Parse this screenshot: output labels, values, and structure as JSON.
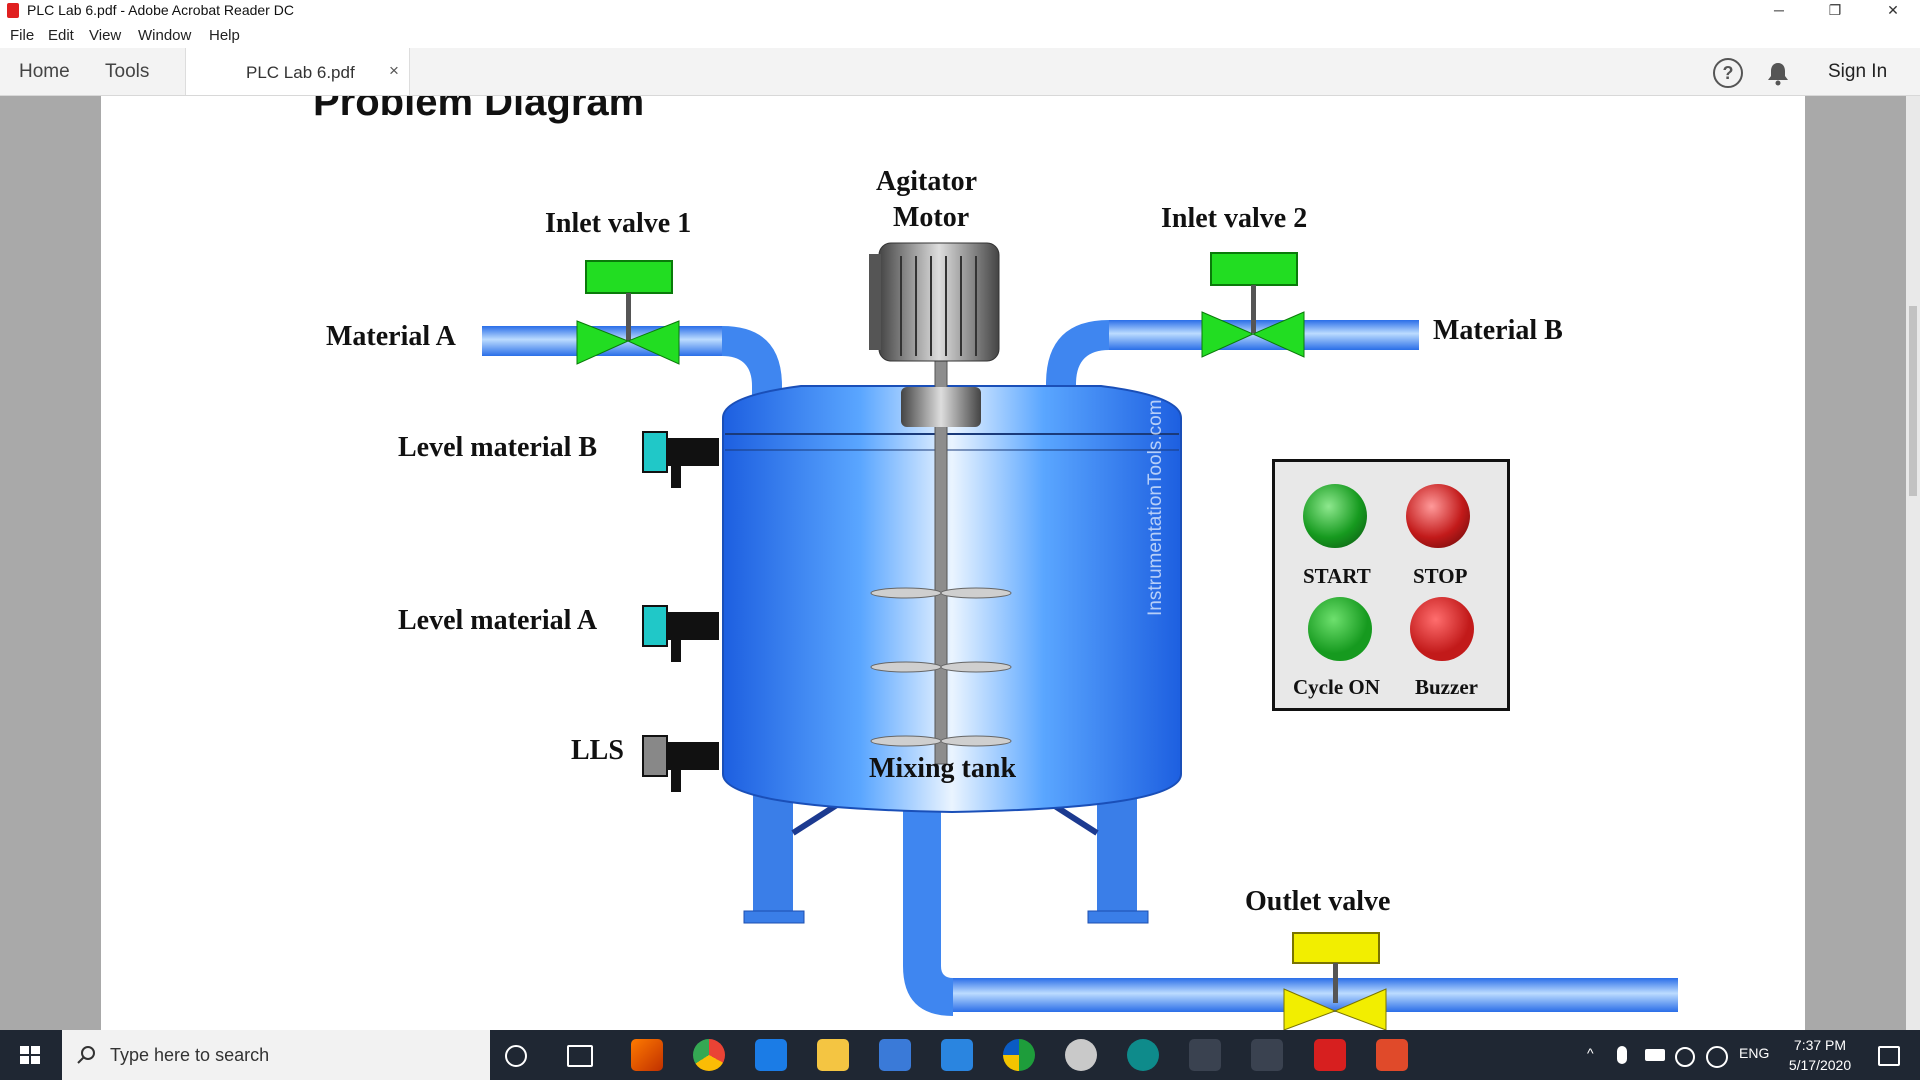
{
  "window": {
    "title": "PLC Lab 6.pdf - Adobe Acrobat Reader DC",
    "minimize": "─",
    "restore": "❐",
    "close": "✕"
  },
  "menu": [
    "File",
    "Edit",
    "View",
    "Window",
    "Help"
  ],
  "tabs": {
    "home": "Home",
    "tools": "Tools",
    "document": "PLC Lab 6.pdf",
    "close_glyph": "×"
  },
  "toolbar_right": {
    "help_icon": "?",
    "bell_icon": "bell-icon",
    "sign_in": "Sign In"
  },
  "document": {
    "heading": "Problem Diagram",
    "labels": {
      "inlet_valve_1": "Inlet valve 1",
      "inlet_valve_2": "Inlet valve 2",
      "agitator_line1": "Agitator",
      "agitator_line2": "Motor",
      "material_a": "Material A",
      "material_b": "Material B",
      "level_b": "Level material B",
      "level_a": "Level material A",
      "lls": "LLS",
      "mixing_tank": "Mixing tank",
      "outlet_valve": "Outlet valve",
      "watermark": "InstrumentationTools.com"
    },
    "panel": {
      "start": "START",
      "stop": "STOP",
      "cycle_on": "Cycle ON",
      "buzzer": "Buzzer"
    },
    "colors": {
      "pipe": "#3f86f0",
      "valve_green": "#22dd22",
      "valve_yellow": "#f2ee00",
      "tank": "#2a78f0",
      "start_btn": "#169a1f",
      "stop_btn": "#c21a1a"
    }
  },
  "taskbar": {
    "search_placeholder": "Type here to search",
    "tray_lang": "ENG",
    "time": "7:37 PM",
    "date": "5/17/2020"
  }
}
